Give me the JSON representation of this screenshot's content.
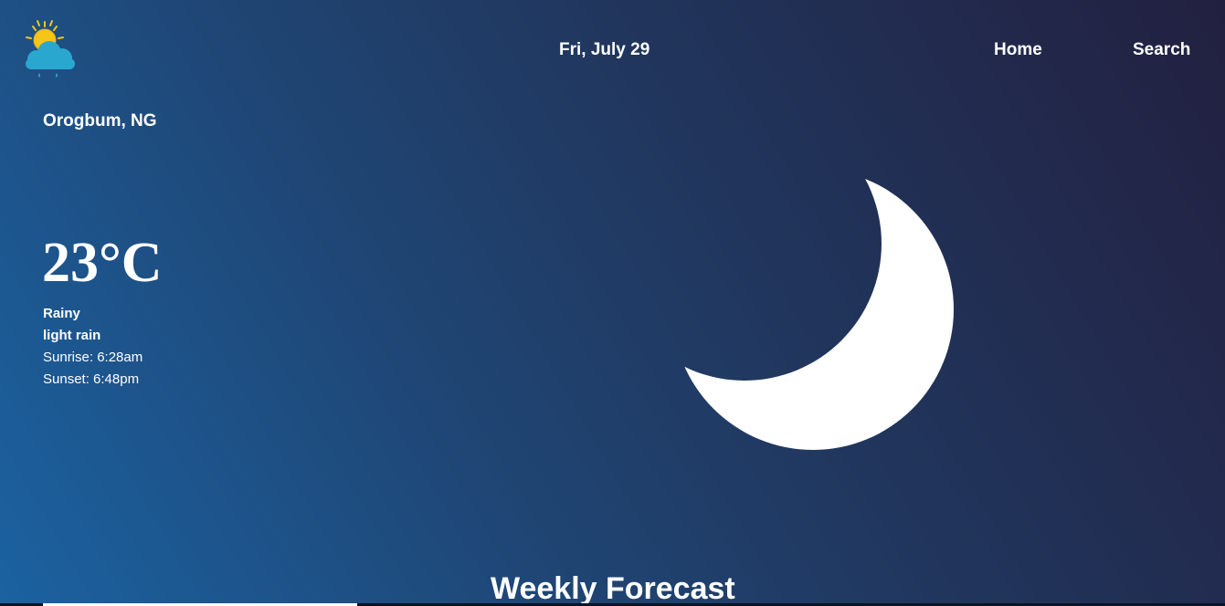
{
  "header": {
    "logo_icon": "sun-cloud-rain-icon",
    "date": "Fri, July 29",
    "nav": {
      "home_label": "Home",
      "search_label": "Search"
    }
  },
  "current": {
    "location": "Orogbum, NG",
    "temperature": "23°C",
    "condition": "Rainy",
    "description": "light rain",
    "sunrise": "Sunrise: 6:28am",
    "sunset": "Sunset: 6:48pm",
    "illustration_icon": "crescent-moon-icon"
  },
  "forecast": {
    "title": "Weekly Forecast"
  },
  "colors": {
    "background_start": "#1b62a1",
    "background_end": "#222040",
    "text": "#ffffff",
    "sun": "#f5c518",
    "cloud": "#2aa7cf"
  }
}
